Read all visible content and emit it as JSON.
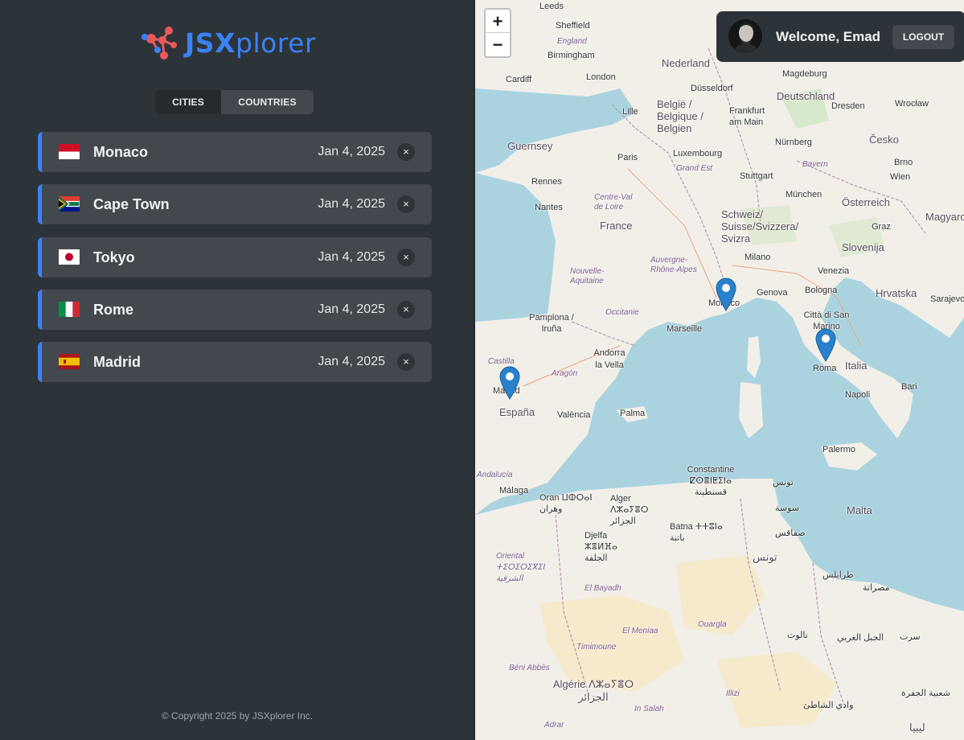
{
  "app": {
    "logo_bold": "JSX",
    "logo_rest": "plorer"
  },
  "tabs": [
    {
      "label": "CITIES",
      "active": true
    },
    {
      "label": "COUNTRIES",
      "active": false
    }
  ],
  "cities": [
    {
      "name": "Monaco",
      "date": "Jan 4, 2025",
      "flag": "monaco-flag-icon"
    },
    {
      "name": "Cape Town",
      "date": "Jan 4, 2025",
      "flag": "south-africa-flag-icon"
    },
    {
      "name": "Tokyo",
      "date": "Jan 4, 2025",
      "flag": "japan-flag-icon"
    },
    {
      "name": "Rome",
      "date": "Jan 4, 2025",
      "flag": "italy-flag-icon"
    },
    {
      "name": "Madrid",
      "date": "Jan 4, 2025",
      "flag": "spain-flag-icon"
    }
  ],
  "delete_symbol": "×",
  "footer": {
    "copyright": "© Copyright 2025 by JSXplorer Inc."
  },
  "map": {
    "zoom_in": "+",
    "zoom_out": "−",
    "labels": {
      "leeds": "Leeds",
      "sheffield": "Sheffield",
      "england": "England",
      "birmingham": "Birmingham",
      "cardiff": "Cardiff",
      "london": "London",
      "nederland": "Nederland",
      "dusseldorf": "Düsseldorf",
      "deutschland": "Deutschland",
      "magdeburg": "Magdeburg",
      "dresden": "Dresden",
      "wroclaw": "Wrocław",
      "belgie": "België / Belgique / Belgien",
      "lille": "Lille",
      "frankfurt": "Frankfurt am Main",
      "guernsey": "Guernsey",
      "paris": "Paris",
      "luxembourg": "Luxembourg",
      "grandest": "Grand Est",
      "nurnberg": "Nürnberg",
      "cesko": "Česko",
      "brno": "Brno",
      "wien": "Wien",
      "stuttgart": "Stuttgart",
      "bayern": "Bayern",
      "rennes": "Rennes",
      "muenchen": "München",
      "osterreich": "Österreich",
      "nantes": "Nantes",
      "centreval": "Centre-Val de Loire",
      "schweiz": "Schweiz/ Suisse/Svizzera/ Svizra",
      "graz": "Graz",
      "magyaro": "Magyaro",
      "france": "France",
      "slovenija": "Slovenija",
      "milano": "Milano",
      "auvergne": "Auvergne- Rhône-Alpes",
      "venezia": "Venezia",
      "nouvelle": "Nouvelle- Aquitaine",
      "genova": "Genova",
      "bologna": "Bologna",
      "hrvatska": "Hrvatska",
      "sarajevo": "Sarajevo",
      "pamplona": "Pamplona / Iruña",
      "occitanie": "Occitanie",
      "monaco": "Monaco",
      "marseille": "Marseille",
      "sanmarino": "Città di San Marino",
      "andorra": "Andorra la Vella",
      "castilla": "Castilla",
      "aragon": "Aragón",
      "roma": "Roma",
      "italia": "Italia",
      "madrid": "Madrid",
      "bari": "Bari",
      "napoli": "Napoli",
      "espana": "España",
      "valencia": "València",
      "palma": "Palma",
      "palermo": "Palermo",
      "andalucia": "Andalucía",
      "constantine": "Constantine ⵇⵙⴻⵏⵟⵉⵏⴰ قسنطينة",
      "tunis": "تونس",
      "malaga": "Málaga",
      "oran": "Oran ⵡⵀⵔⴰⵏ وهران",
      "alger": "Alger ⴷⵣⴰⵢⴻⵔ الجزائر",
      "sousse": "سوسة",
      "malta": "Malta",
      "batna": "Batna ⵜⵜⵓⵏⴰ باتنة",
      "sfax": "صفاقس",
      "djelfa": "Djelfa ⵣⴻⵍⴼⴰ الجلفة",
      "tunisia": "تونس",
      "oriental": "Oriental ⵜⵉⵔⵉⵔⵉⴳⵉⵏ الشرقية",
      "tripoli": "طرابلس",
      "misrata": "مصراتة",
      "elbayadh": "El Bayadh",
      "elmeniaa": "El Meniaa",
      "ouargla": "Ouargla",
      "timimoune": "Timimoune",
      "beniabbes": "Béni Abbès",
      "algerie": "Algérie ⴷⵣⴰⵢⴻⵔ الجزائر",
      "illizi": "Illizi",
      "insalah": "In Salah",
      "adrar": "Adrar",
      "libya": "ليبيا",
      "alwadi": "وادي الشاطئ",
      "jabal": "الجبل الغربي",
      "nalut": "نالوت",
      "sirte": "سرت",
      "jufra": "شعبية الجفرة"
    }
  },
  "user": {
    "welcome": "Welcome, Emad",
    "logout": "LOGOUT"
  },
  "colors": {
    "accent": "#3b82f6",
    "sidebar_bg": "#2d3439",
    "item_bg": "#42484e",
    "sea": "#aad3df",
    "land": "#f2efe9"
  }
}
